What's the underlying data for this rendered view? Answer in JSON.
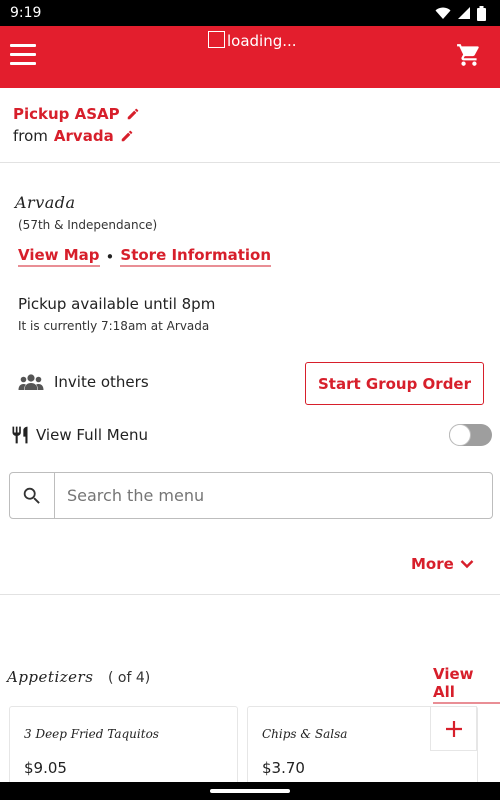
{
  "status_bar": {
    "time": "9:19"
  },
  "header": {
    "title": "loading..."
  },
  "pickup": {
    "mode_label": "Pickup ASAP",
    "from_label": "from",
    "location": "Arvada"
  },
  "store": {
    "name": "Arvada",
    "subtitle": "(57th & Independance)",
    "view_map": "View Map",
    "separator": "•",
    "store_info": "Store Information",
    "availability": "Pickup available until 8pm",
    "current_time": "It is currently 7:18am at Arvada"
  },
  "group": {
    "invite_label": "Invite others",
    "start_button": "Start Group Order"
  },
  "menu_toggle": {
    "label": "View Full Menu",
    "enabled": false
  },
  "search": {
    "placeholder": "Search the menu",
    "value": ""
  },
  "more": {
    "label": "More"
  },
  "category": {
    "title": "Appetizers",
    "count": "( of 4)",
    "view_all": "View All",
    "items": [
      {
        "name": "3 Deep Fried Taquitos",
        "price": "$9.05"
      },
      {
        "name": "Chips & Salsa",
        "price": "$3.70"
      }
    ]
  },
  "colors": {
    "brand": "#e31e2d",
    "accent": "#d71f2b"
  }
}
